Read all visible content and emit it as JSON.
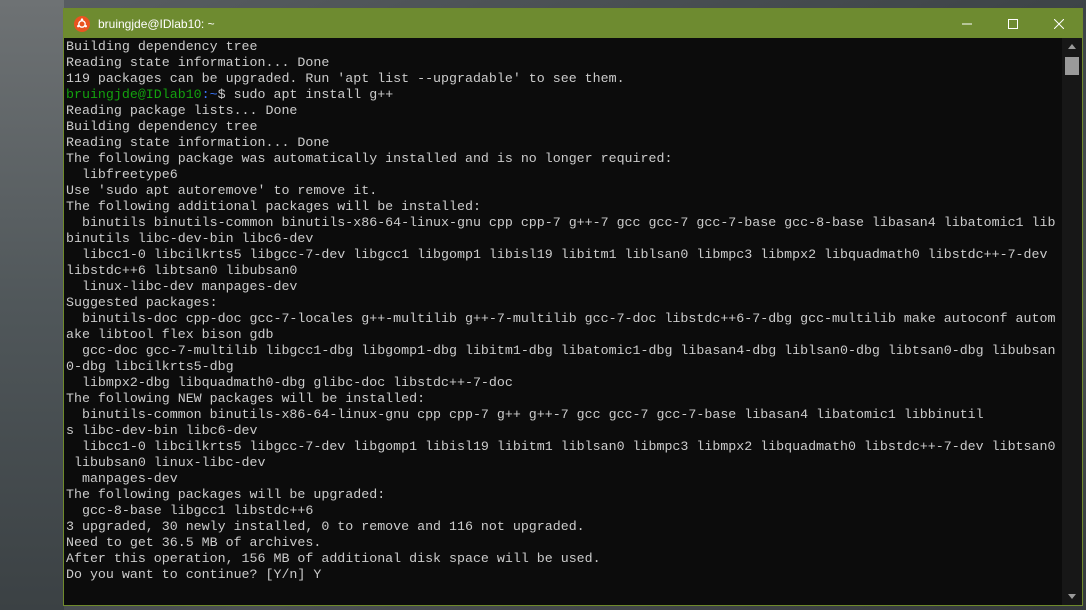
{
  "window": {
    "title": "bruingjde@IDlab10: ~",
    "icon": "ubuntu-icon",
    "accent_color": "#6e8b30"
  },
  "controls": {
    "minimize_icon": "minimize-icon",
    "maximize_icon": "maximize-icon",
    "close_icon": "close-icon"
  },
  "terminal": {
    "lines": [
      "Building dependency tree",
      "Reading state information... Done",
      "119 packages can be upgraded. Run 'apt list --upgradable' to see them."
    ],
    "prompt": {
      "user": "bruingjde@IDlab10",
      "path": ":~",
      "command": "$ sudo apt install g++"
    },
    "output": [
      "Reading package lists... Done",
      "Building dependency tree",
      "Reading state information... Done",
      "The following package was automatically installed and is no longer required:",
      "  libfreetype6",
      "Use 'sudo apt autoremove' to remove it.",
      "The following additional packages will be installed:",
      "  binutils binutils-common binutils-x86-64-linux-gnu cpp cpp-7 g++-7 gcc gcc-7 gcc-7-base gcc-8-base libasan4 libatomic1 lib",
      "binutils libc-dev-bin libc6-dev",
      "  libcc1-0 libcilkrts5 libgcc-7-dev libgcc1 libgomp1 libisl19 libitm1 liblsan0 libmpc3 libmpx2 libquadmath0 libstdc++-7-dev",
      "libstdc++6 libtsan0 libubsan0",
      "  linux-libc-dev manpages-dev",
      "Suggested packages:",
      "  binutils-doc cpp-doc gcc-7-locales g++-multilib g++-7-multilib gcc-7-doc libstdc++6-7-dbg gcc-multilib make autoconf autom",
      "ake libtool flex bison gdb",
      "  gcc-doc gcc-7-multilib libgcc1-dbg libgomp1-dbg libitm1-dbg libatomic1-dbg libasan4-dbg liblsan0-dbg libtsan0-dbg libubsan",
      "0-dbg libcilkrts5-dbg",
      "  libmpx2-dbg libquadmath0-dbg glibc-doc libstdc++-7-doc",
      "The following NEW packages will be installed:",
      "  binutils-common binutils-x86-64-linux-gnu cpp cpp-7 g++ g++-7 gcc gcc-7 gcc-7-base libasan4 libatomic1 libbinutil",
      "s libc-dev-bin libc6-dev",
      "  libcc1-0 libcilkrts5 libgcc-7-dev libgomp1 libisl19 libitm1 liblsan0 libmpc3 libmpx2 libquadmath0 libstdc++-7-dev libtsan0",
      " libubsan0 linux-libc-dev",
      "  manpages-dev",
      "The following packages will be upgraded:",
      "  gcc-8-base libgcc1 libstdc++6",
      "3 upgraded, 30 newly installed, 0 to remove and 116 not upgraded.",
      "Need to get 36.5 MB of archives.",
      "After this operation, 156 MB of additional disk space will be used.",
      "Do you want to continue? [Y/n] Y"
    ]
  },
  "scrollbar": {
    "up_icon": "scroll-up-arrow-icon",
    "down_icon": "scroll-down-arrow-icon"
  }
}
